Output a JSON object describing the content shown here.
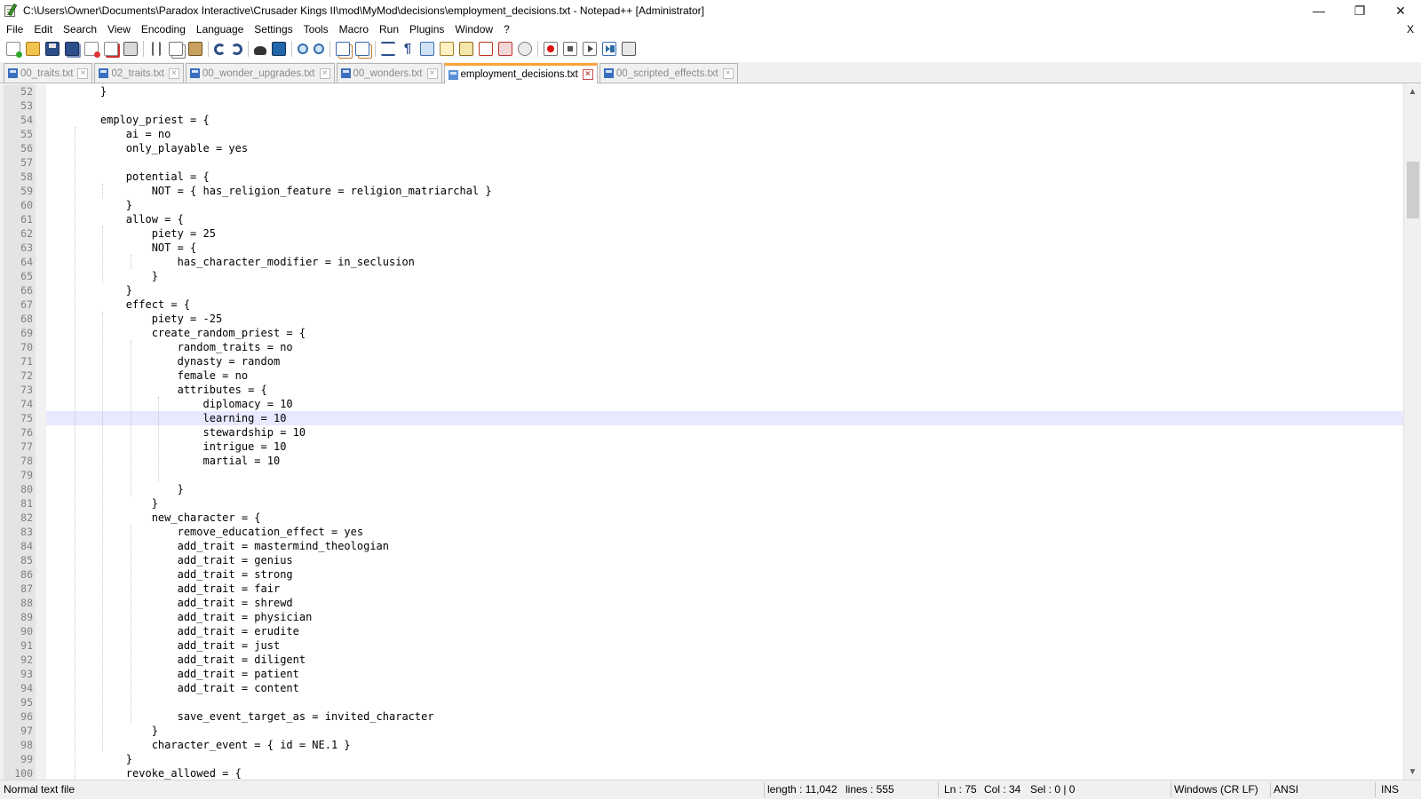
{
  "window": {
    "title": "C:\\Users\\Owner\\Documents\\Paradox Interactive\\Crusader Kings II\\mod\\MyMod\\decisions\\employment_decisions.txt - Notepad++ [Administrator]",
    "minimize": "—",
    "maximize": "❐",
    "close": "✕"
  },
  "menu": {
    "items": [
      "File",
      "Edit",
      "Search",
      "View",
      "Encoding",
      "Language",
      "Settings",
      "Tools",
      "Macro",
      "Run",
      "Plugins",
      "Window",
      "?"
    ],
    "close_doc": "X"
  },
  "toolbar": {
    "icons": [
      "new-file-icon",
      "open-file-icon",
      "save-icon",
      "save-all-icon",
      "close-icon",
      "close-all-icon",
      "print-icon",
      "cut-icon",
      "copy-icon",
      "paste-icon",
      "undo-icon",
      "redo-icon",
      "find-icon",
      "replace-icon",
      "zoom-in-icon",
      "zoom-out-icon",
      "sync-vertical-icon",
      "sync-horizontal-icon",
      "word-wrap-icon",
      "show-all-characters-icon",
      "indent-guide-icon",
      "user-defined-language-icon",
      "document-map-icon",
      "function-list-icon",
      "folder-as-workspace-icon",
      "monitoring-icon",
      "record-macro-icon",
      "stop-recording-icon",
      "playback-macro-icon",
      "run-macro-multiple-icon",
      "save-macro-icon"
    ]
  },
  "tabs": [
    {
      "label": "00_traits.txt",
      "active": false
    },
    {
      "label": "02_traits.txt",
      "active": false
    },
    {
      "label": "00_wonder_upgrades.txt",
      "active": false
    },
    {
      "label": "00_wonders.txt",
      "active": false
    },
    {
      "label": "employment_decisions.txt",
      "active": true
    },
    {
      "label": "00_scripted_effects.txt",
      "active": false
    }
  ],
  "editor": {
    "current_line": 75,
    "lines": [
      {
        "n": "52",
        "text": "    }"
      },
      {
        "n": "53",
        "text": ""
      },
      {
        "n": "54",
        "text": "    employ_priest = {"
      },
      {
        "n": "55",
        "text": "        ai = no"
      },
      {
        "n": "56",
        "text": "        only_playable = yes"
      },
      {
        "n": "57",
        "text": ""
      },
      {
        "n": "58",
        "text": "        potential = {"
      },
      {
        "n": "59",
        "text": "            NOT = { has_religion_feature = religion_matriarchal }"
      },
      {
        "n": "60",
        "text": "        }"
      },
      {
        "n": "61",
        "text": "        allow = {"
      },
      {
        "n": "62",
        "text": "            piety = 25"
      },
      {
        "n": "63",
        "text": "            NOT = {"
      },
      {
        "n": "64",
        "text": "                has_character_modifier = in_seclusion"
      },
      {
        "n": "65",
        "text": "            }"
      },
      {
        "n": "66",
        "text": "        }"
      },
      {
        "n": "67",
        "text": "        effect = {"
      },
      {
        "n": "68",
        "text": "            piety = -25"
      },
      {
        "n": "69",
        "text": "            create_random_priest = {"
      },
      {
        "n": "70",
        "text": "                random_traits = no"
      },
      {
        "n": "71",
        "text": "                dynasty = random"
      },
      {
        "n": "72",
        "text": "                female = no"
      },
      {
        "n": "73",
        "text": "                attributes = {"
      },
      {
        "n": "74",
        "text": "                    diplomacy = 10"
      },
      {
        "n": "75",
        "text": "                    learning = 10"
      },
      {
        "n": "76",
        "text": "                    stewardship = 10"
      },
      {
        "n": "77",
        "text": "                    intrigue = 10"
      },
      {
        "n": "78",
        "text": "                    martial = 10"
      },
      {
        "n": "79",
        "text": ""
      },
      {
        "n": "80",
        "text": "                }"
      },
      {
        "n": "81",
        "text": "            }"
      },
      {
        "n": "82",
        "text": "            new_character = {"
      },
      {
        "n": "83",
        "text": "                remove_education_effect = yes"
      },
      {
        "n": "84",
        "text": "                add_trait = mastermind_theologian"
      },
      {
        "n": "85",
        "text": "                add_trait = genius"
      },
      {
        "n": "86",
        "text": "                add_trait = strong"
      },
      {
        "n": "87",
        "text": "                add_trait = fair"
      },
      {
        "n": "88",
        "text": "                add_trait = shrewd"
      },
      {
        "n": "89",
        "text": "                add_trait = physician"
      },
      {
        "n": "90",
        "text": "                add_trait = erudite"
      },
      {
        "n": "91",
        "text": "                add_trait = just"
      },
      {
        "n": "92",
        "text": "                add_trait = diligent"
      },
      {
        "n": "93",
        "text": "                add_trait = patient"
      },
      {
        "n": "94",
        "text": "                add_trait = content"
      },
      {
        "n": "95",
        "text": ""
      },
      {
        "n": "96",
        "text": "                save_event_target_as = invited_character"
      },
      {
        "n": "97",
        "text": "            }"
      },
      {
        "n": "98",
        "text": "            character_event = { id = NE.1 }"
      },
      {
        "n": "99",
        "text": "        }"
      },
      {
        "n": "100",
        "text": "        revoke_allowed = {"
      }
    ]
  },
  "scrollbar": {
    "up": "▲",
    "down": "▼",
    "scroll_position": 0.1
  },
  "status": {
    "file_type": "Normal text file",
    "length": "length : 11,042",
    "lines": "lines : 555",
    "ln": "Ln : 75",
    "col": "Col : 34",
    "sel": "Sel : 0 | 0",
    "eol": "Windows (CR LF)",
    "encoding": "ANSI",
    "mode": "INS"
  }
}
